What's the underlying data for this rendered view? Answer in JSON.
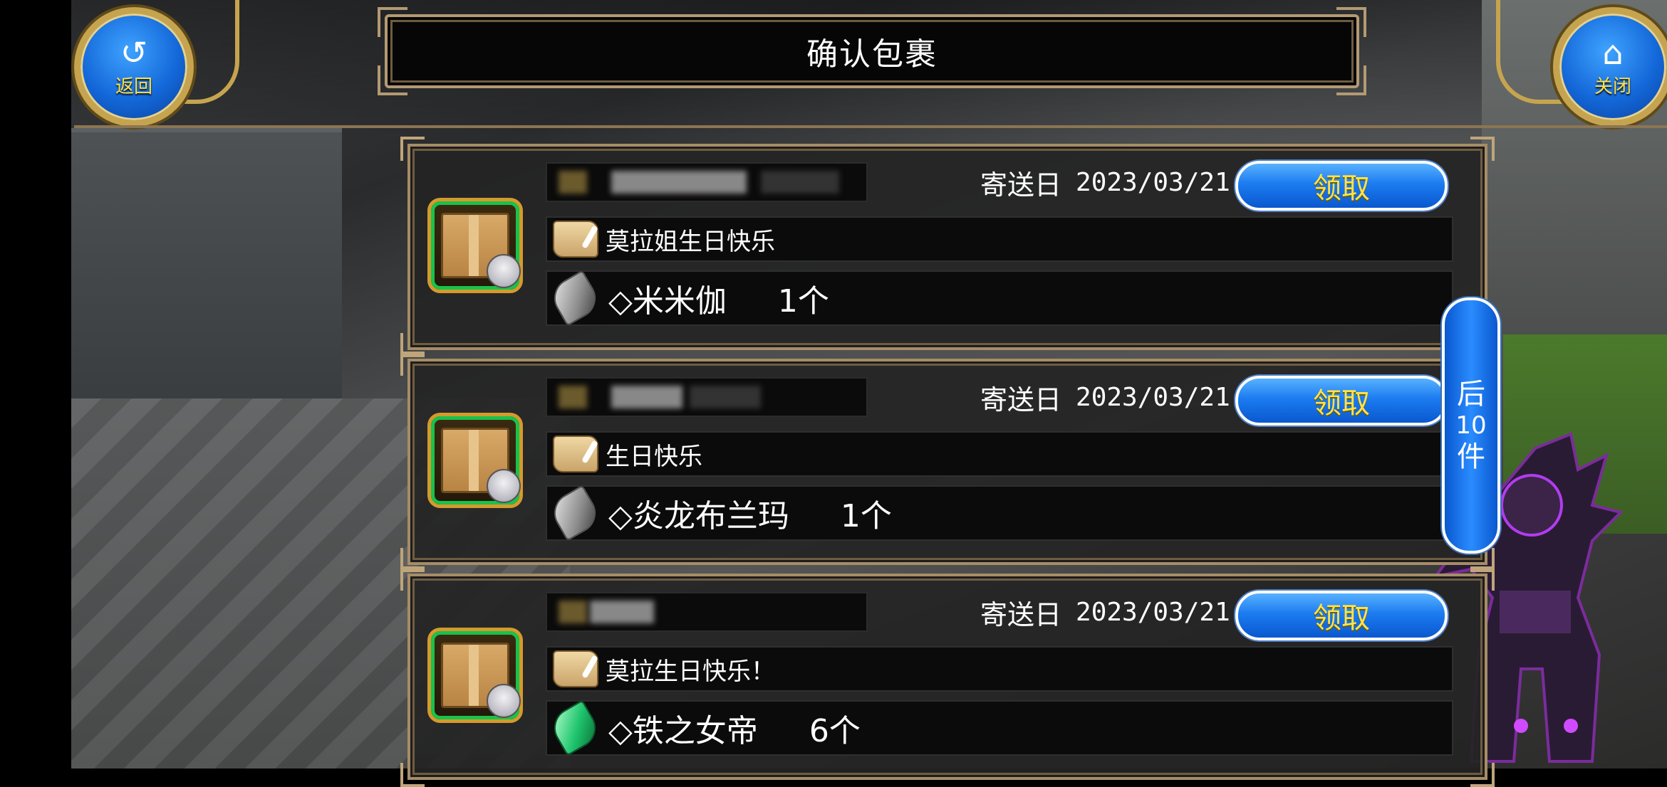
{
  "title": "确认包裹",
  "nav": {
    "back_label": "返回",
    "close_label": "关闭",
    "back_icon": "return-arrow-icon",
    "close_icon": "home-icon"
  },
  "next_page": {
    "line1": "后",
    "line2": "10",
    "line3": "件"
  },
  "date_label": "寄送日",
  "claim_label": "领取",
  "parcels": [
    {
      "date": "2023/03/21",
      "message": "莫拉姐生日快乐",
      "item_name": "◇米米伽",
      "item_qty": "1个",
      "item_icon": "silver-leaf-icon"
    },
    {
      "date": "2023/03/21",
      "message": "生日快乐",
      "item_name": "◇炎龙布兰玛",
      "item_qty": "1个",
      "item_icon": "silver-leaf-icon"
    },
    {
      "date": "2023/03/21",
      "message": "莫拉生日快乐！",
      "item_name": "◇铁之女帝",
      "item_qty": "6个",
      "item_icon": "green-leaf-icon"
    }
  ],
  "colors": {
    "accent_blue": "#1c7cf0",
    "claim_text": "#ffe34b",
    "frame_gold": "#b39a72",
    "package_border": "#19c24b"
  }
}
